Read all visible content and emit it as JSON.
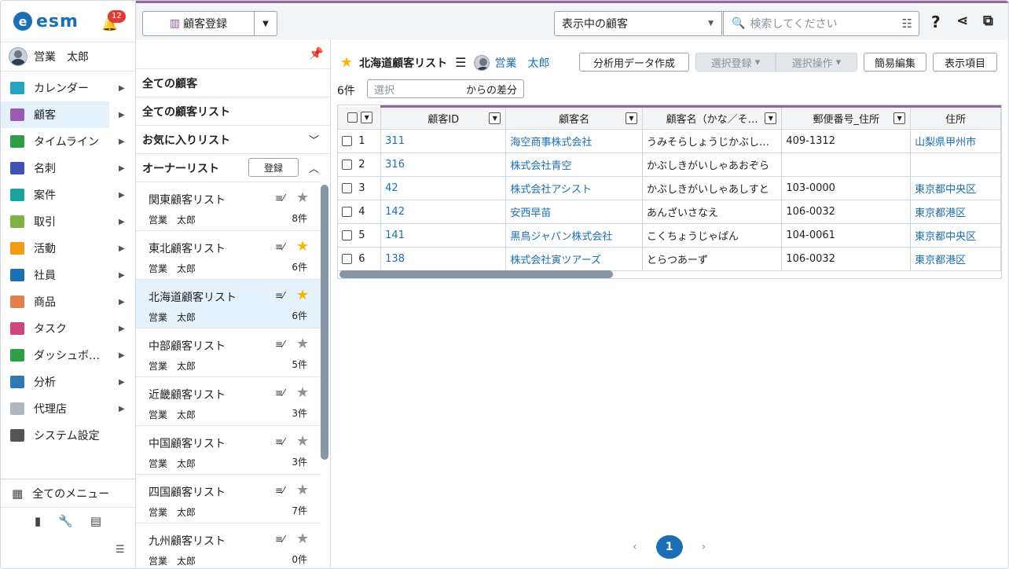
{
  "app": {
    "logo": "esm",
    "logo_letter": "e",
    "notifications": "12"
  },
  "user": {
    "name": "営業　太郎"
  },
  "menu": [
    {
      "label": "カレンダー",
      "icon": "calendar-icon",
      "color": "#27a3c4"
    },
    {
      "label": "顧客",
      "icon": "building-icon",
      "color": "#9b59b6",
      "active": true
    },
    {
      "label": "タイムライン",
      "icon": "chat-icon",
      "color": "#2e9e44"
    },
    {
      "label": "名刺",
      "icon": "card-icon",
      "color": "#3f51b5"
    },
    {
      "label": "案件",
      "icon": "folder-icon",
      "color": "#1aa39a"
    },
    {
      "label": "取引",
      "icon": "deal-icon",
      "color": "#7cb342"
    },
    {
      "label": "活動",
      "icon": "clipboard-icon",
      "color": "#f39c12"
    },
    {
      "label": "社員",
      "icon": "person-icon",
      "color": "#1a6fb5"
    },
    {
      "label": "商品",
      "icon": "box-icon",
      "color": "#e67e4d"
    },
    {
      "label": "タスク",
      "icon": "task-icon",
      "color": "#d0457a"
    },
    {
      "label": "ダッシュボ…",
      "icon": "dashboard-icon",
      "color": "#2e9e44"
    },
    {
      "label": "分析",
      "icon": "chart-icon",
      "color": "#2c7bb6"
    },
    {
      "label": "代理店",
      "icon": "doc-icon",
      "color": "#b0b7bf"
    },
    {
      "label": "システム設定",
      "icon": "gear-icon",
      "color": "#555555"
    }
  ],
  "all_menu": "全てのメニュー",
  "topbar": {
    "register": "顧客登録",
    "scope": "表示中の顧客",
    "search_placeholder": "検索してください"
  },
  "listpanel": {
    "all_customers": "全ての顧客",
    "all_lists": "全ての顧客リスト",
    "favorites": "お気に入りリスト",
    "owner_lists": "オーナーリスト",
    "register": "登録",
    "lists": [
      {
        "name": "関東顧客リスト",
        "owner": "営業　太郎",
        "count": "8件",
        "fav": false
      },
      {
        "name": "東北顧客リスト",
        "owner": "営業　太郎",
        "count": "6件",
        "fav": true
      },
      {
        "name": "北海道顧客リスト",
        "owner": "営業　太郎",
        "count": "6件",
        "fav": true,
        "selected": true
      },
      {
        "name": "中部顧客リスト",
        "owner": "営業　太郎",
        "count": "5件",
        "fav": false
      },
      {
        "name": "近畿顧客リスト",
        "owner": "営業　太郎",
        "count": "3件",
        "fav": false
      },
      {
        "name": "中国顧客リスト",
        "owner": "営業　太郎",
        "count": "3件",
        "fav": false
      },
      {
        "name": "四国顧客リスト",
        "owner": "営業　太郎",
        "count": "7件",
        "fav": false
      },
      {
        "name": "九州顧客リスト",
        "owner": "営業　太郎",
        "count": "0件",
        "fav": false
      }
    ]
  },
  "main": {
    "title": "北海道顧客リスト",
    "owner": "営業　太郎",
    "btn_analysis": "分析用データ作成",
    "btn_select_register": "選択登録",
    "btn_select_ops": "選択操作",
    "btn_quick_edit": "簡易編集",
    "btn_columns": "表示項目",
    "count": "6件",
    "diff_placeholder": "選択",
    "diff_label": "からの差分"
  },
  "table": {
    "headers": [
      "顧客ID",
      "顧客名",
      "顧客名（かな／そ…",
      "郵便番号_住所",
      "住所"
    ],
    "rows": [
      {
        "n": "1",
        "id": "311",
        "name": "海空商事株式会社",
        "kana": "うみそらしょうじかぶし…",
        "zip": "409-1312",
        "addr": "山梨県甲州市"
      },
      {
        "n": "2",
        "id": "316",
        "name": "株式会社青空",
        "kana": "かぶしきがいしゃあおぞら",
        "zip": "",
        "addr": ""
      },
      {
        "n": "3",
        "id": "42",
        "name": "株式会社アシスト",
        "kana": "かぶしきがいしゃあしすと",
        "zip": "103-0000",
        "addr": "東京都中央区"
      },
      {
        "n": "4",
        "id": "142",
        "name": "安西早苗",
        "kana": "あんざいさなえ",
        "zip": "106-0032",
        "addr": "東京都港区"
      },
      {
        "n": "5",
        "id": "141",
        "name": "黒鳥ジャパン株式会社",
        "kana": "こくちょうじゃぱん",
        "zip": "104-0061",
        "addr": "東京都中央区"
      },
      {
        "n": "6",
        "id": "138",
        "name": "株式会社寅ツアーズ",
        "kana": "とらつあーず",
        "zip": "106-0032",
        "addr": "東京都港区"
      }
    ]
  },
  "pager": {
    "prev": "‹",
    "page": "1",
    "next": "›"
  }
}
